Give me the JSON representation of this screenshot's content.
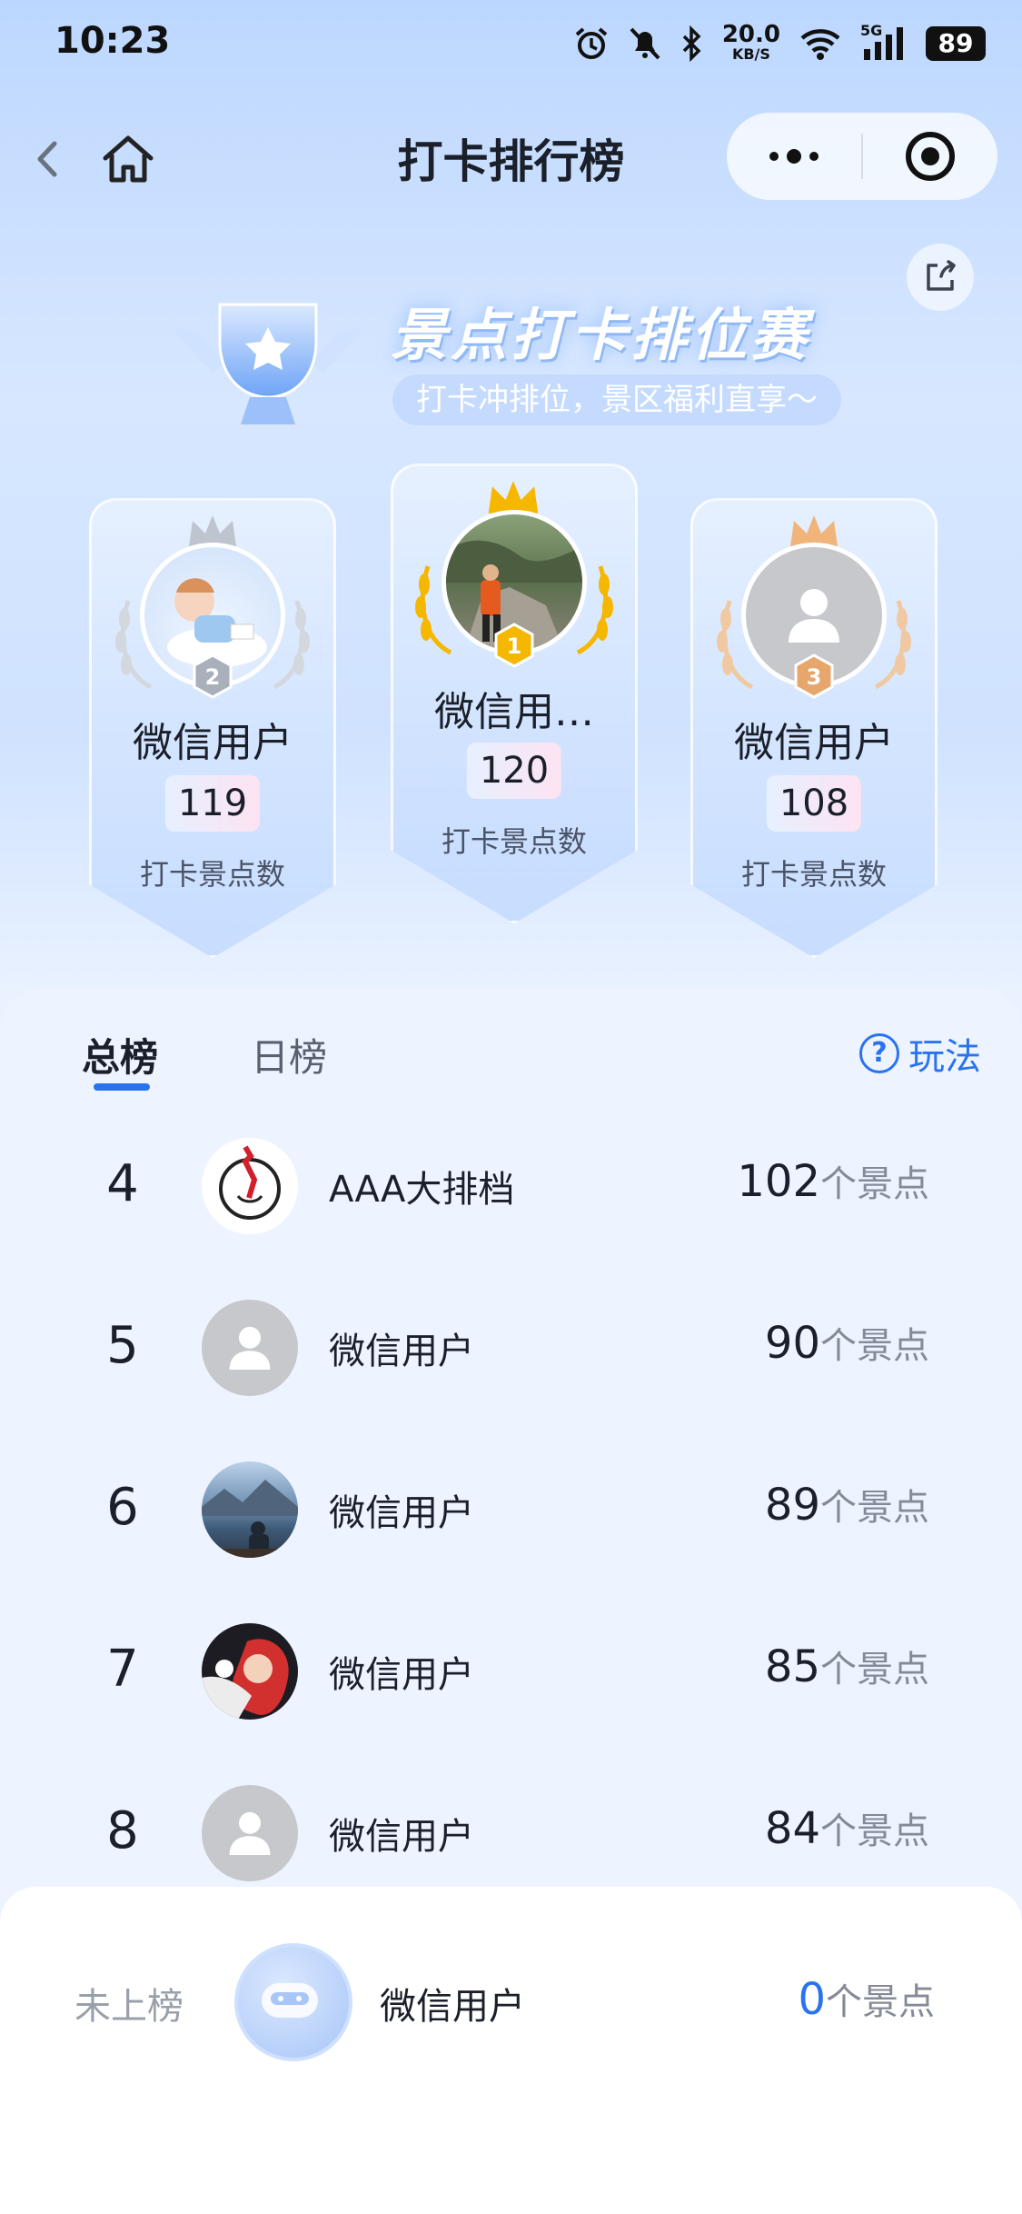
{
  "status_bar": {
    "time": "10:23",
    "network_speed_value": "20.0",
    "network_speed_unit": "KB/S",
    "signal_label": "5G",
    "battery": "89"
  },
  "nav": {
    "title": "打卡排行榜"
  },
  "banner": {
    "title": "景点打卡排位赛",
    "subtitle": "打卡冲排位，景区福利直享～"
  },
  "podium": [
    {
      "rank": "1",
      "name": "微信用…",
      "score": "120",
      "label": "打卡景点数"
    },
    {
      "rank": "2",
      "name": "微信用户",
      "score": "119",
      "label": "打卡景点数"
    },
    {
      "rank": "3",
      "name": "微信用户",
      "score": "108",
      "label": "打卡景点数"
    }
  ],
  "tabs": {
    "total": "总榜",
    "daily": "日榜",
    "rules": "玩法",
    "rules_icon": "?"
  },
  "ranking": [
    {
      "rank": "4",
      "name": "AAA大排档",
      "count": "102",
      "unit": "个景点"
    },
    {
      "rank": "5",
      "name": "微信用户",
      "count": "90",
      "unit": "个景点"
    },
    {
      "rank": "6",
      "name": "微信用户",
      "count": "89",
      "unit": "个景点"
    },
    {
      "rank": "7",
      "name": "微信用户",
      "count": "85",
      "unit": "个景点"
    },
    {
      "rank": "8",
      "name": "微信用户",
      "count": "84",
      "unit": "个景点"
    }
  ],
  "my_rank": {
    "status": "未上榜",
    "name": "微信用户",
    "count": "0",
    "unit": "个景点"
  },
  "colors": {
    "accent": "#2a73f0",
    "gold": "#f5b700",
    "silver": "#a9b0bb",
    "bronze": "#e7a66b"
  }
}
